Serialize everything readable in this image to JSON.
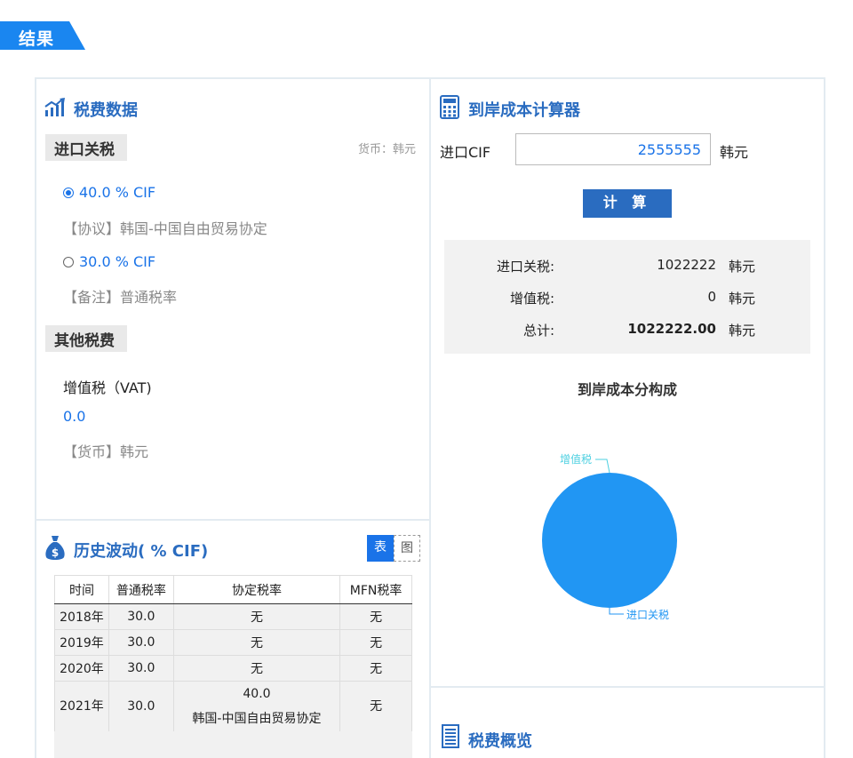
{
  "result_tag": "结果",
  "tax_data": {
    "title": "税费数据",
    "import_duty_label": "进口关税",
    "currency_note": "货币：韩元",
    "options": [
      {
        "rate": "40.0 % CIF",
        "note": "【协议】韩国-中国自由贸易协定",
        "selected": true
      },
      {
        "rate": "30.0 % CIF",
        "note": "【备注】普通税率",
        "selected": false
      }
    ],
    "other_label": "其他税费",
    "vat_name": "增值税（VAT)",
    "vat_value": "0.0",
    "vat_currency": "【货币】韩元"
  },
  "history": {
    "title": "历史波动( % CIF)",
    "toggle_table": "表",
    "toggle_chart": "图",
    "headers": [
      "时间",
      "普通税率",
      "协定税率",
      "MFN税率"
    ],
    "rows": [
      [
        "2018年",
        "30.0",
        "无",
        "无"
      ],
      [
        "2019年",
        "30.0",
        "无",
        "无"
      ],
      [
        "2020年",
        "30.0",
        "无",
        "无"
      ],
      [
        "2021年",
        "30.0",
        "40.0",
        "无"
      ]
    ],
    "last_row_note": "韩国-中国自由贸易协定"
  },
  "calculator": {
    "title": "到岸成本计算器",
    "cif_label": "进口CIF",
    "cif_value": "2555555",
    "cif_unit": "韩元",
    "button": "计 算",
    "results": [
      {
        "label": "进口关税:",
        "value": "1022222",
        "unit": "韩元"
      },
      {
        "label": "增值税:",
        "value": "0",
        "unit": "韩元"
      },
      {
        "label": "总计:",
        "value": "1022222.00",
        "unit": "韩元"
      }
    ]
  },
  "chart_data": {
    "type": "pie",
    "title": "到岸成本分构成",
    "categories": [
      "进口关税",
      "增值税"
    ],
    "values": [
      1022222,
      0
    ],
    "colors": [
      "#2196f3",
      "#4dd0e1"
    ]
  },
  "overview": {
    "title": "税费概览"
  }
}
